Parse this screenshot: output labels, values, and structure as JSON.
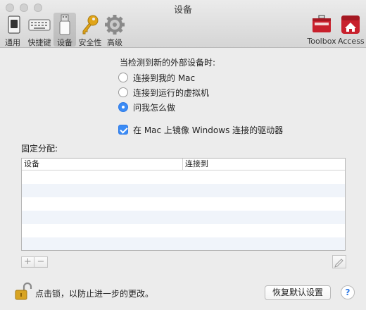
{
  "window": {
    "title": "设备"
  },
  "toolbar": {
    "items": [
      {
        "label": "通用",
        "icon": "general-switch-icon"
      },
      {
        "label": "快捷键",
        "icon": "keyboard-icon"
      },
      {
        "label": "设备",
        "icon": "usb-device-icon",
        "active": true
      },
      {
        "label": "安全性",
        "icon": "key-icon"
      },
      {
        "label": "高级",
        "icon": "gear-icon"
      },
      {
        "label": "Toolbox",
        "icon": "toolbox-icon"
      },
      {
        "label": "Access",
        "icon": "access-icon"
      }
    ]
  },
  "devices": {
    "prompt": "当检测到新的外部设备时:",
    "options": [
      {
        "label": "连接到我的 Mac",
        "selected": false
      },
      {
        "label": "连接到运行的虚拟机",
        "selected": false
      },
      {
        "label": "问我怎么做",
        "selected": true
      }
    ],
    "mirror_checkbox": {
      "label": "在 Mac 上镜像 Windows 连接的驱动器",
      "checked": true
    }
  },
  "assignment": {
    "label": "固定分配:",
    "columns": [
      "设备",
      "连接到"
    ],
    "rows": []
  },
  "list_controls": {
    "add": "+",
    "remove": "−"
  },
  "footer": {
    "lock_text": "点击锁，以防止进一步的更改。",
    "restore_button": "恢复默认设置",
    "help_button": "?"
  },
  "colors": {
    "accent": "#3b8bf5",
    "toolbox_red": "#c8202c",
    "access_red": "#c8202c",
    "key_gold": "#e0a418"
  }
}
